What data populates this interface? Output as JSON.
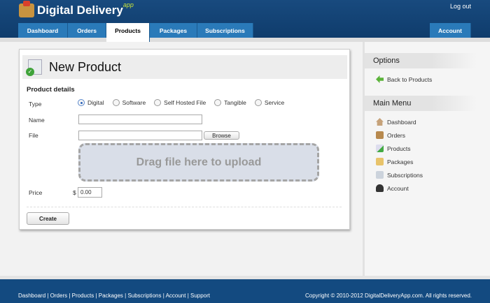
{
  "header": {
    "logo": "Digital Delivery",
    "logo_sup": "app",
    "logout": "Log out"
  },
  "tabs": [
    {
      "label": "Dashboard"
    },
    {
      "label": "Orders"
    },
    {
      "label": "Products"
    },
    {
      "label": "Packages"
    },
    {
      "label": "Subscriptions"
    },
    {
      "label": "Account"
    }
  ],
  "panel": {
    "title": "New Product",
    "section": "Product details",
    "type_label": "Type",
    "types": [
      "Digital",
      "Software",
      "Self Hosted File",
      "Tangible",
      "Service"
    ],
    "selected_type": "Digital",
    "name_label": "Name",
    "name_value": "",
    "file_label": "File",
    "file_value": "",
    "browse": "Browse",
    "drop_text": "Drag file here to upload",
    "price_label": "Price",
    "currency": "$",
    "price_value": "0.00",
    "create": "Create"
  },
  "sidebar": {
    "options_title": "Options",
    "back": "Back to Products",
    "menu_title": "Main Menu",
    "menu": [
      {
        "label": "Dashboard",
        "icon": "home-icon"
      },
      {
        "label": "Orders",
        "icon": "clipboard-icon"
      },
      {
        "label": "Products",
        "icon": "product-icon"
      },
      {
        "label": "Packages",
        "icon": "package-icon"
      },
      {
        "label": "Subscriptions",
        "icon": "subscription-icon"
      },
      {
        "label": "Account",
        "icon": "user-icon"
      }
    ]
  },
  "footer": {
    "links": [
      "Dashboard",
      "Orders",
      "Products",
      "Packages",
      "Subscriptions",
      "Account",
      "Support"
    ],
    "copyright": "Copyright © 2010-2012 DigitalDeliveryApp.com. All rights reserved."
  }
}
